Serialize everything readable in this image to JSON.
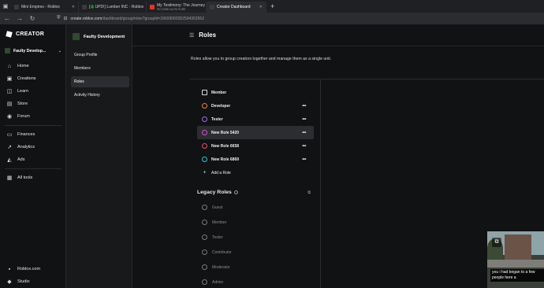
{
  "browser": {
    "tabs": [
      {
        "title": "Mini Empires - Roblox",
        "favicon_color": "#3a3a3a",
        "active": false
      },
      {
        "title": "[🌲UPD!] Lumber INC - Roblox",
        "favicon_color": "#3a3a3a",
        "active": false
      },
      {
        "title": "My Testimony: The Journey fro",
        "subtitle": "PICTURE-IN-PICTURE",
        "favicon_color": "#e0352a",
        "active": false
      },
      {
        "title": "Creator Dashboard",
        "favicon_color": "#3a3a3a",
        "active": true
      }
    ],
    "new_tab_label": "+",
    "address": {
      "host": "create.roblox.com",
      "path": "/dashboard/group/roles?groupId=18693060352594352652"
    }
  },
  "left_nav": {
    "brand": "CREATOR",
    "group_name": "Faulty Develop...",
    "items_top": [
      {
        "label": "Home",
        "icon": "home-icon",
        "glyph": "⌂"
      },
      {
        "label": "Creations",
        "icon": "creations-icon",
        "glyph": "▣"
      },
      {
        "label": "Learn",
        "icon": "learn-icon",
        "glyph": "◫"
      },
      {
        "label": "Store",
        "icon": "store-icon",
        "glyph": "▤"
      },
      {
        "label": "Forum",
        "icon": "forum-icon",
        "glyph": "◉"
      }
    ],
    "items_mid": [
      {
        "label": "Finances",
        "icon": "finances-icon",
        "glyph": "▭"
      },
      {
        "label": "Analytics",
        "icon": "analytics-icon",
        "glyph": "↗"
      },
      {
        "label": "Ads",
        "icon": "ads-icon",
        "glyph": "◭"
      }
    ],
    "all_tools": {
      "label": "All tools",
      "icon": "all-tools-icon",
      "glyph": "▦"
    },
    "items_bottom": [
      {
        "label": "Roblox.com",
        "icon": "roblox-icon",
        "glyph": "▪"
      },
      {
        "label": "Studio",
        "icon": "studio-icon",
        "glyph": "◆"
      }
    ]
  },
  "sub_nav": {
    "title": "Faulty Development",
    "items": [
      {
        "label": "Group Profile",
        "active": false
      },
      {
        "label": "Members",
        "active": false
      },
      {
        "label": "Roles",
        "active": true
      },
      {
        "label": "Activity History",
        "active": false
      }
    ]
  },
  "main": {
    "title": "Roles",
    "description": "Roles allow you to group creators together and manage them as a single unit.",
    "roles": [
      {
        "label": "Member",
        "color": "#d9d9d9",
        "glyph": "▣",
        "square": true,
        "has_more": false
      },
      {
        "label": "Developer",
        "color": "#e8813a",
        "glyph": "",
        "has_more": true
      },
      {
        "label": "Tester",
        "color": "#9a6cf0",
        "glyph": "",
        "has_more": true
      },
      {
        "label": "New Role 5420",
        "color": "#d64fc8",
        "glyph": "",
        "has_more": true,
        "selected": true
      },
      {
        "label": "New Role 6658",
        "color": "#e0535a",
        "glyph": "",
        "has_more": true
      },
      {
        "label": "New Role 6869",
        "color": "#2fc7c4",
        "glyph": "",
        "has_more": true
      }
    ],
    "add_role_label": "Add a Role",
    "legacy": {
      "title": "Legacy Roles",
      "roles": [
        "Guest",
        "Member",
        "Tester",
        "Contributor",
        "Moderator",
        "Admin"
      ]
    }
  },
  "pip": {
    "caption": "you i had began to a few people here a"
  }
}
